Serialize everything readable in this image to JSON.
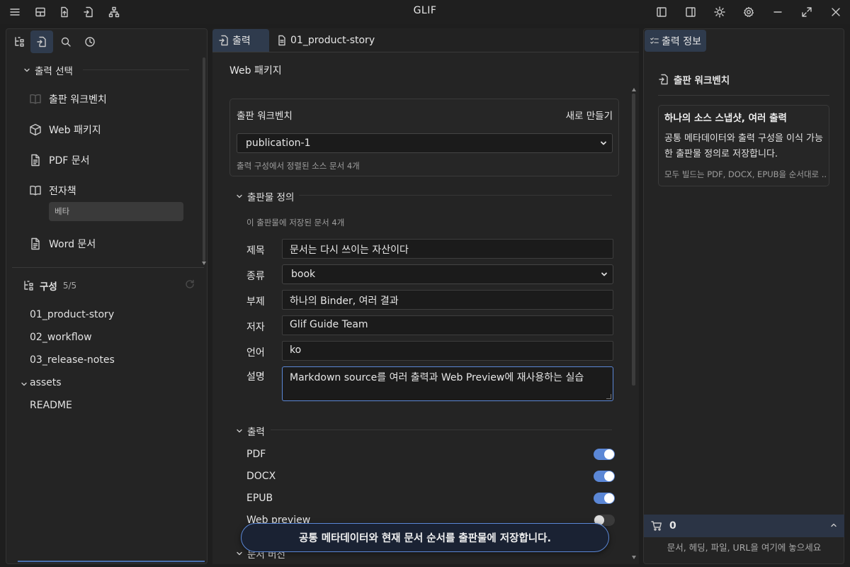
{
  "app": {
    "title": "GLIF"
  },
  "left": {
    "export_section": "출력 선택",
    "nav": [
      {
        "label": "출판 워크벤치",
        "icon": "book-open-icon"
      },
      {
        "label": "Web 패키지",
        "icon": "package-icon"
      },
      {
        "label": "PDF 문서",
        "icon": "file-text-icon"
      },
      {
        "label": "전자책",
        "icon": "book-icon"
      },
      {
        "label": "Word 문서",
        "icon": "file-text-icon"
      }
    ],
    "badge_beta": "베타",
    "config_title": "구성",
    "config_count": "5/5",
    "tree": [
      "01_product-story",
      "02_workflow",
      "03_release-notes",
      "assets",
      "README"
    ]
  },
  "tabs": [
    {
      "label": "출력"
    },
    {
      "label": "01_product-story"
    }
  ],
  "main": {
    "heading": "Web 패키지",
    "card": {
      "title": "출판 워크벤치",
      "new_label": "새로 만들기",
      "selected": "publication-1",
      "hint": "출력 구성에서 정렬된 소스 문서 4개"
    },
    "definition": {
      "title": "출판물 정의",
      "hint": "이 출판물에 저장된 문서 4개",
      "fields": [
        {
          "label": "제목",
          "value": "문서는 다시 쓰이는 자산이다"
        },
        {
          "label": "종류",
          "value": "book"
        },
        {
          "label": "부제",
          "value": "하나의 Binder, 여러 결과"
        },
        {
          "label": "저자",
          "value": "Glif Guide Team"
        },
        {
          "label": "언어",
          "value": "ko"
        },
        {
          "label": "설명",
          "value": "Markdown source를 여러 출력과 Web Preview에 재사용하는 실습"
        }
      ]
    },
    "outputs": {
      "title": "출력",
      "items": [
        {
          "label": "PDF",
          "on": true
        },
        {
          "label": "DOCX",
          "on": true
        },
        {
          "label": "EPUB",
          "on": true
        },
        {
          "label": "Web preview",
          "on": false
        }
      ]
    },
    "next_section": "문서 버전",
    "toast": "공통 메타데이터와 현재 문서 순서를 출판물에 저장합니다."
  },
  "right": {
    "tab": "출력 정보",
    "section": "출판 워크벤치",
    "card_title": "하나의 소스 스냅샷, 여러 출력",
    "card_body": "공통 메타데이터와 출력 구성을 이식 가능한 출판물 정의로 저장합니다.",
    "card_note": "모두 빌드는 PDF, DOCX, EPUB을 순서대로 ...",
    "cart_count": "0",
    "drop_hint": "문서, 헤딩, 파일, URL을 여기에 놓으세요"
  },
  "colors": {
    "accent": "#5b87d6",
    "active_tab": "#2f3b4d",
    "toast_border": "#5b87d6"
  }
}
